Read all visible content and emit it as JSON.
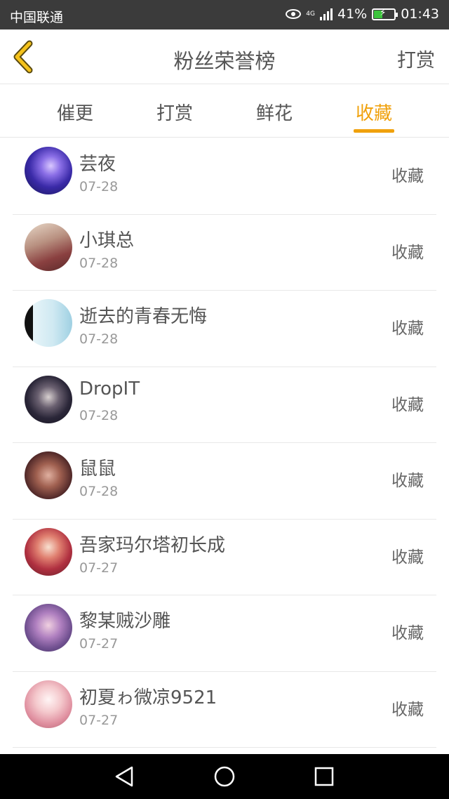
{
  "status_bar": {
    "carrier": "中国联通",
    "network": "4G",
    "battery": "41%",
    "battery_level": 0.41,
    "time": "01:43"
  },
  "header": {
    "title": "粉丝荣誉榜",
    "right_action": "打赏"
  },
  "tabs": [
    {
      "label": "催更",
      "active": false
    },
    {
      "label": "打赏",
      "active": false
    },
    {
      "label": "鲜花",
      "active": false
    },
    {
      "label": "收藏",
      "active": true
    }
  ],
  "colors": {
    "accent": "#f0a10c",
    "status_bar": "#3b3b3b",
    "nav_bar": "#000000"
  },
  "fans": [
    {
      "name": "芸夜",
      "date": "07-28",
      "action": "收藏"
    },
    {
      "name": "小琪总",
      "date": "07-28",
      "action": "收藏"
    },
    {
      "name": "逝去的青春无悔",
      "date": "07-28",
      "action": "收藏"
    },
    {
      "name": "DropIT",
      "date": "07-28",
      "action": "收藏"
    },
    {
      "name": "鼠鼠",
      "date": "07-28",
      "action": "收藏"
    },
    {
      "name": "吾家玛尔塔初长成",
      "date": "07-27",
      "action": "收藏"
    },
    {
      "name": "黎某贼沙雕",
      "date": "07-27",
      "action": "收藏"
    },
    {
      "name": "初夏ゎ微凉9521",
      "date": "07-27",
      "action": "收藏"
    }
  ]
}
